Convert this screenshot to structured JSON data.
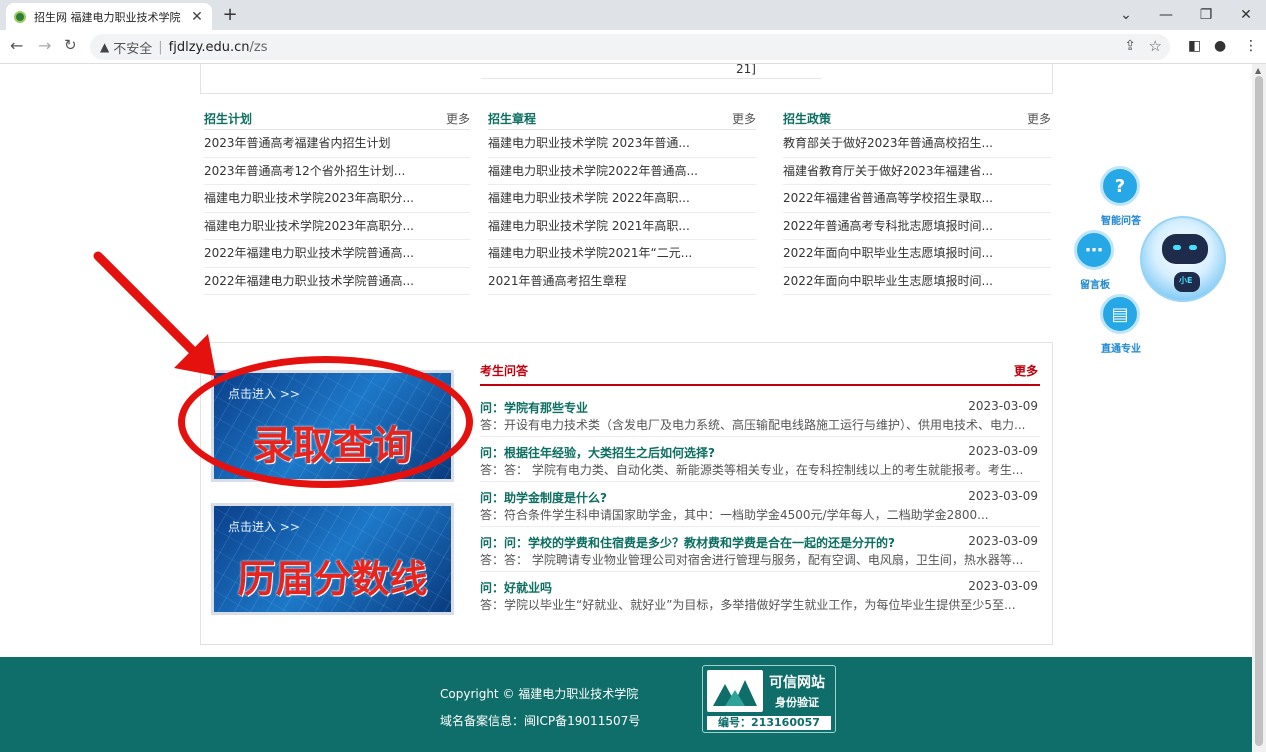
{
  "browser": {
    "tab_title": "招生网 福建电力职业技术学院",
    "tab_close": "✕",
    "new_tab": "+",
    "security_label": "不安全",
    "url_host": "fjdlzy.edu.cn",
    "url_path": "/zs",
    "window_controls": [
      "⌄",
      "—",
      "❐",
      "✕"
    ]
  },
  "top_fragment": "21]",
  "columns": [
    {
      "title": "招生计划",
      "more": "更多",
      "items": [
        "2023年普通高考福建省内招生计划",
        "2023年普通高考12个省外招生计划...",
        "福建电力职业技术学院2023年高职分...",
        "福建电力职业技术学院2023年高职分...",
        "2022年福建电力职业技术学院普通高...",
        "2022年福建电力职业技术学院普通高..."
      ]
    },
    {
      "title": "招生章程",
      "more": "更多",
      "items": [
        "福建电力职业技术学院 2023年普通...",
        "福建电力职业技术学院2022年普通高...",
        "福建电力职业技术学院 2022年高职...",
        "福建电力职业技术学院 2021年高职...",
        "福建电力职业技术学院2021年“二元...",
        "2021年普通高考招生章程"
      ]
    },
    {
      "title": "招生政策",
      "more": "更多",
      "items": [
        "教育部关于做好2023年普通高校招生...",
        "福建省教育厅关于做好2023年福建省...",
        "2022年福建省普通高等学校招生录取...",
        "2022年普通高考专科批志愿填报时间...",
        "2022年面向中职毕业生志愿填报时间...",
        "2022年面向中职毕业生志愿填报时间..."
      ]
    }
  ],
  "banners": [
    {
      "enter": "点击进入 >>",
      "title": "录取查询"
    },
    {
      "enter": "点击进入 >>",
      "title": "历届分数线"
    }
  ],
  "qa": {
    "title": "考生问答",
    "more": "更多",
    "items": [
      {
        "q": "问：学院有那些专业",
        "date": "2023-03-09",
        "a": "答：开设有电力技术类（含发电厂及电力系统、高压输配电线路施工运行与维护）、供用电技术、电力..."
      },
      {
        "q": "问：根据往年经验，大类招生之后如何选择?",
        "date": "2023-03-09",
        "a": "答：答： 学院有电力类、自动化类、新能源类等相关专业，在专科控制线以上的考生就能报考。考生..."
      },
      {
        "q": "问：助学金制度是什么?",
        "date": "2023-03-09",
        "a": "答：符合条件学生科申请国家助学金，其中：一档助学金4500元/学年每人，二档助学金2800..."
      },
      {
        "q": "问：问：学校的学费和住宿费是多少？教材费和学费是合在一起的还是分开的?",
        "date": "2023-03-09",
        "a": "答：答： 学院聘请专业物业管理公司对宿舍进行管理与服务，配有空调、电风扇，卫生间，热水器等..."
      },
      {
        "q": "问：好就业吗",
        "date": "2023-03-09",
        "a": "答：学院以毕业生“好就业、就好业”为目标，多举措做好学生就业工作，为每位毕业生提供至少5至..."
      }
    ]
  },
  "helpers": [
    {
      "label": "智能问答",
      "glyph": "?"
    },
    {
      "label": "留言板",
      "glyph": "⋯"
    },
    {
      "label": "直通专业",
      "glyph": "▤"
    }
  ],
  "robot_tag": "小E",
  "footer": {
    "copyright": "Copyright © 福建电力职业技术学院",
    "icp": "域名备案信息：闽ICP备19011507号",
    "trust_title": "可信网站",
    "trust_sub": "身份验证",
    "trust_no": "编号：213160057"
  },
  "colors": {
    "accent_green": "#0d6e62",
    "qa_red": "#c0000c",
    "footer_bg": "#0f6e6a",
    "annotation_red": "#e4110f"
  }
}
